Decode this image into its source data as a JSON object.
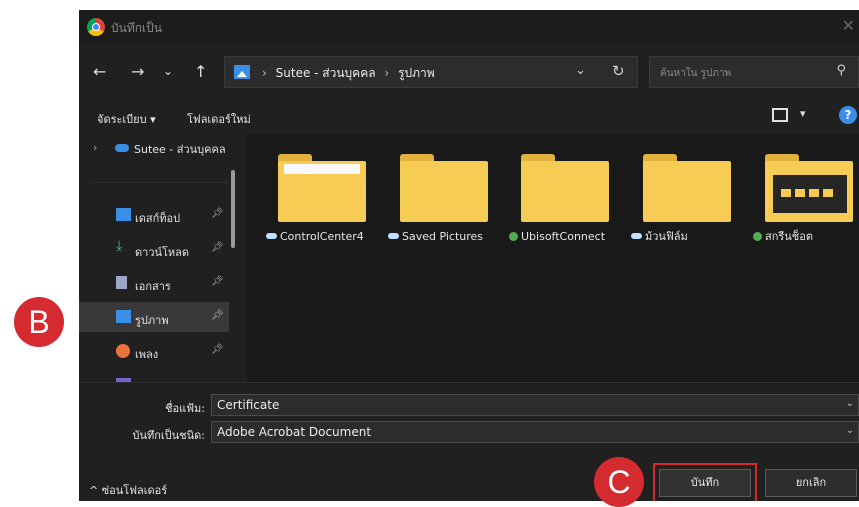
{
  "title": "บันทึกเป็น",
  "address": {
    "crumbs": [
      "Sutee - ส่วนบุคคล",
      "รูปภาพ"
    ],
    "dropdown_icon": "chevron-down-icon",
    "refresh_icon": "refresh-icon"
  },
  "search": {
    "placeholder": "ค้นหาใน รูปภาพ"
  },
  "toolbar": {
    "organize": "จัดระเบียบ ▾",
    "new_folder": "โฟลเดอร์ใหม่",
    "help": "?"
  },
  "sidebar": {
    "top": "Sutee - ส่วนบุคคล",
    "items": [
      {
        "label": "เดสก์ท็อป",
        "color": "#3a8ee6"
      },
      {
        "label": "ดาวน์โหลด",
        "color": "#4fb3a8"
      },
      {
        "label": "เอกสาร",
        "color": "#9aa7c9"
      },
      {
        "label": "รูปภาพ",
        "color": "#3a8ee6"
      },
      {
        "label": "เพลง",
        "color": "#e8743b"
      }
    ]
  },
  "files": [
    {
      "name": "ControlCenter4",
      "status": "cloud"
    },
    {
      "name": "Saved Pictures",
      "status": "cloud"
    },
    {
      "name": "UbisoftConnect",
      "status": "ok"
    },
    {
      "name": "ม้วนฟิล์ม",
      "status": "cloud"
    },
    {
      "name": "สกรีนช็อต",
      "status": "ok"
    }
  ],
  "form": {
    "filename_label": "ชื่อแฟ้ม:",
    "filename_value": "Certificate",
    "type_label": "บันทึกเป็นชนิด:",
    "type_value": "Adobe Acrobat Document"
  },
  "footer": {
    "hide_folders": "^ ซ่อนโฟลเดอร์",
    "save": "บันทึก",
    "cancel": "ยกเลิก"
  },
  "annotations": {
    "b": "B",
    "c": "C",
    "color": "#d52b30"
  }
}
